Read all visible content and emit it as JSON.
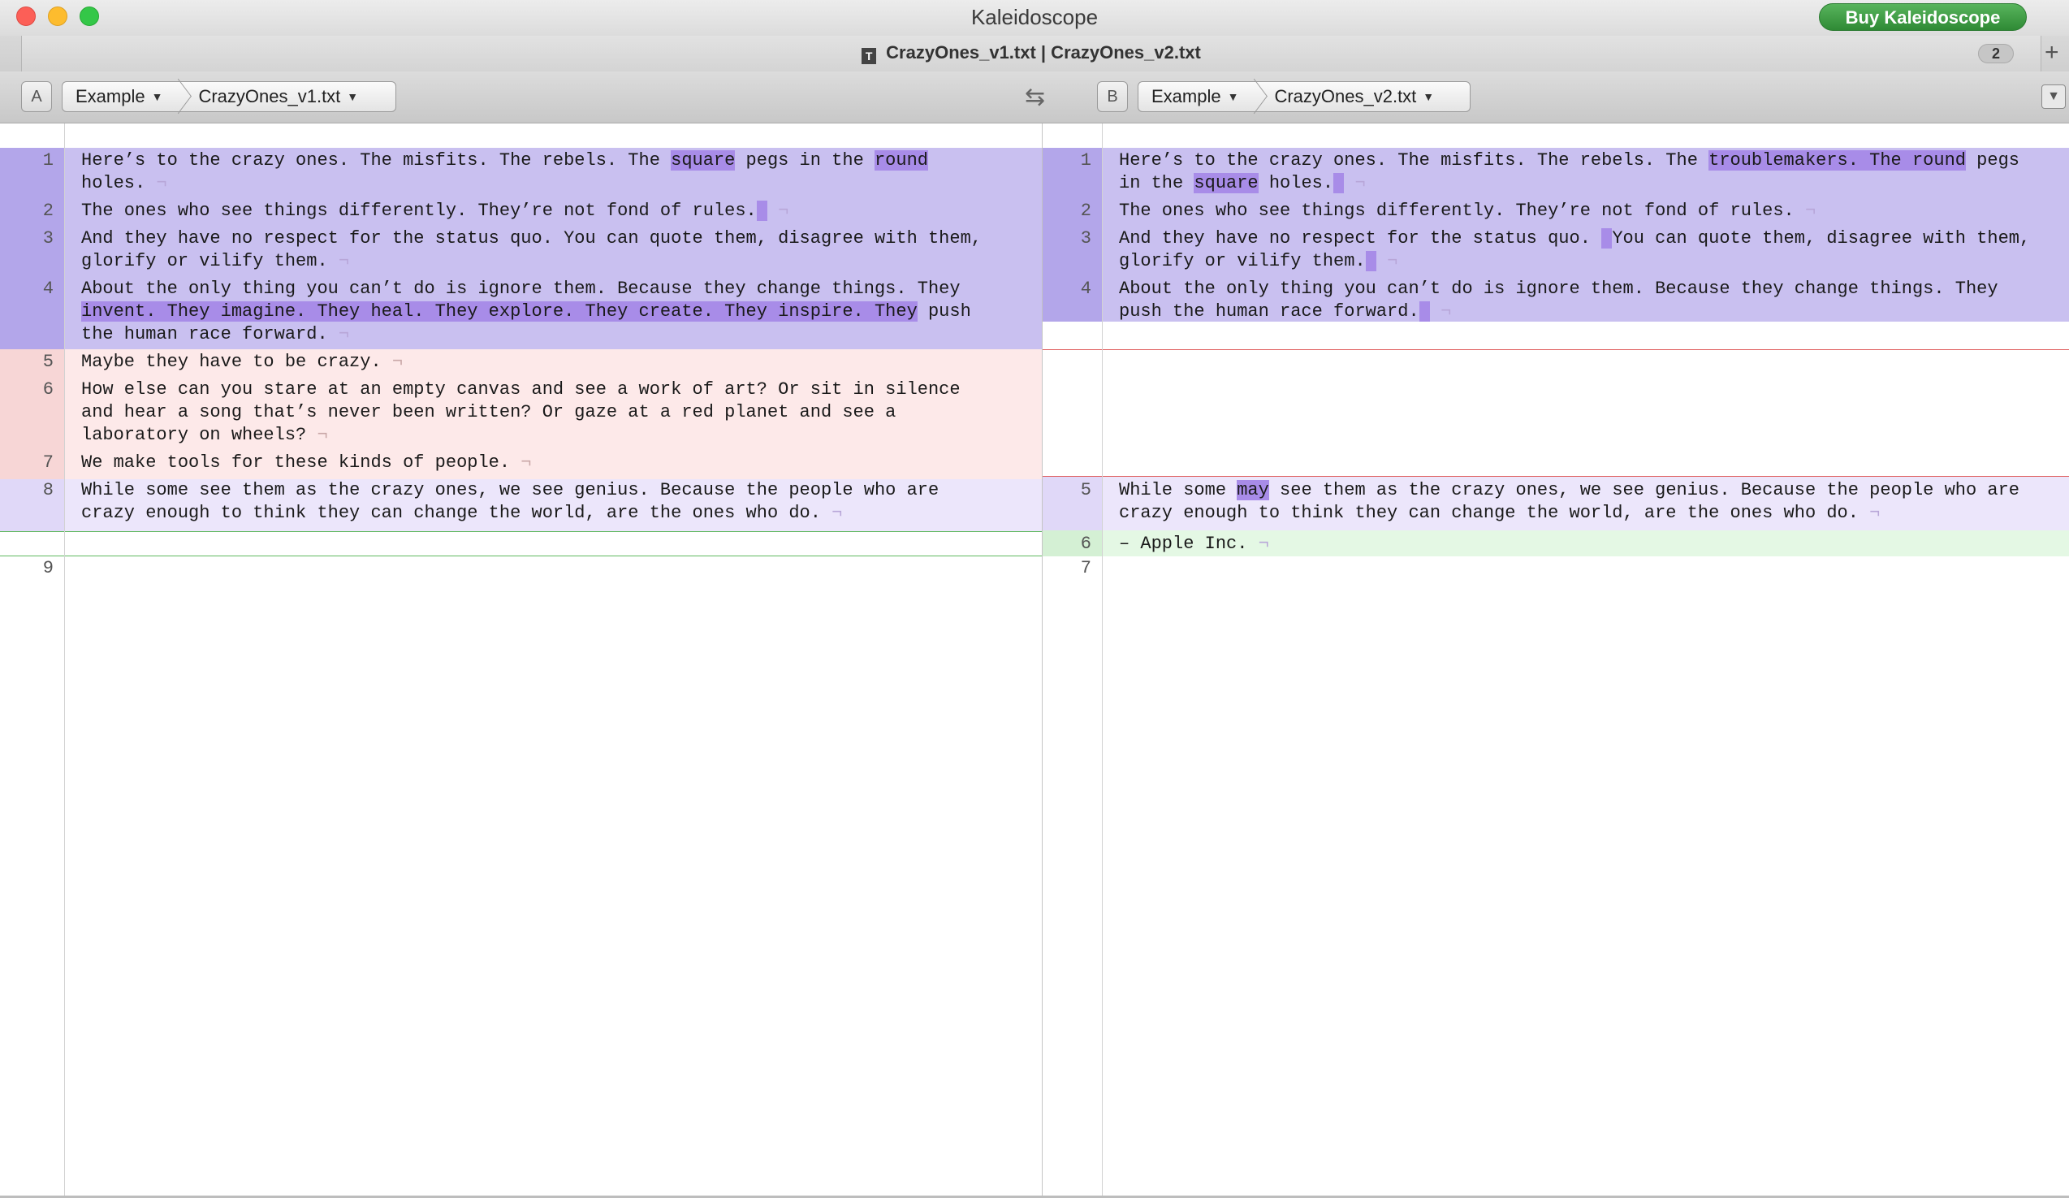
{
  "window": {
    "title": "Kaleidoscope",
    "buy_label": "Buy Kaleidoscope"
  },
  "tab": {
    "title": "CrazyOnes_v1.txt | CrazyOnes_v2.txt",
    "icon": "T",
    "count": "2",
    "add": "+"
  },
  "pathbar": {
    "left": {
      "letter": "A",
      "folder": "Example",
      "file": "CrazyOnes_v1.txt"
    },
    "right": {
      "letter": "B",
      "folder": "Example",
      "file": "CrazyOnes_v2.txt"
    },
    "swap_icon": "⇆",
    "panel_icon": "▼"
  },
  "colors": {
    "changed_bg": "#c9c0f0",
    "changed_gutter": "#b3a6ea",
    "deleted_bg": "#fde9e9",
    "deleted_gutter": "#f7d6d6",
    "inserted_bg": "#e4f8e4",
    "light_changed_bg": "#ece6fb",
    "word_highlight": "#a88ce8"
  },
  "left": {
    "nums": [
      "1",
      "2",
      "3",
      "4",
      "5",
      "6",
      "7",
      "8",
      "9"
    ],
    "l1a": "Here’s to the crazy ones. The misfits. The rebels. The ",
    "l1b": "square",
    "l1c": " pegs in the ",
    "l1d": "round",
    "l1e": "holes.",
    "l2a": "The ones who see things differently. They’re not fond of rules.",
    "l3a": "And they have no respect for the status quo. ",
    "l3b": "You can quote them, disagree with them,",
    "l3c": "glorify or vilify them.",
    "l4a": "About the only thing you can’t do is ignore them. Because they change things. They",
    "l4b": "invent. They imagine. They heal. They explore. They create. They inspire. They",
    "l4c": " push",
    "l4d": "the human race forward.",
    "l5": "Maybe they have to be crazy.",
    "l6a": "How else can you stare at an empty canvas and see a work of art? Or sit in silence",
    "l6b": "and hear a song that’s never been written? Or gaze at a red planet and see a",
    "l6c": "laboratory on wheels?",
    "l7": "We make tools for these kinds of people.",
    "l8a": "While some ",
    "l8b": "see them as the crazy ones, we see genius. Because the people who are",
    "l8c": "crazy enough to think they can change the world, are the ones who do.",
    "eol": "¬"
  },
  "right": {
    "nums": [
      "1",
      "2",
      "3",
      "4",
      "5",
      "6",
      "7"
    ],
    "r1a": "Here’s to the crazy ones. The misfits. The rebels. The ",
    "r1b": "troublemakers. The round",
    "r1c": " pegs",
    "r1d": "in the ",
    "r1e": "square",
    "r1f": " holes.",
    "r2a": "The ones who see things differently. They’re not fond of rules.",
    "r3a": "And they have no respect for the status quo. ",
    "r3b": "You can quote them, disagree with them,",
    "r3c": "glorify or vilify them.",
    "r4a": "About the only thing you can’t do is ignore them. Because they change things. They",
    "r4b": "push the human race forward.",
    "r5a": "While some ",
    "r5b": "may",
    "r5c": " see them as the crazy ones, we see genius. Because the people who are",
    "r5d": "crazy enough to think they can change the world, are the ones who do.",
    "r6": "– Apple Inc.",
    "eol": "¬"
  }
}
